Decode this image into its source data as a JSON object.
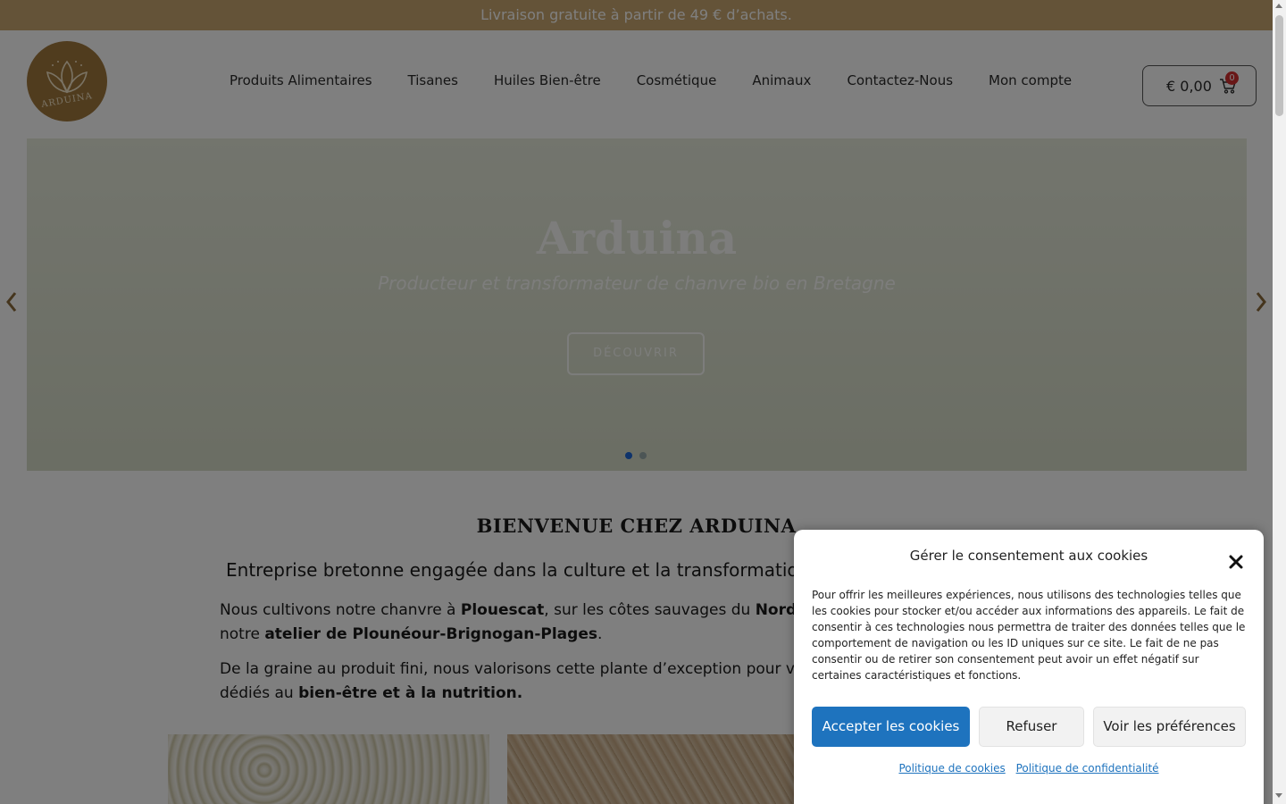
{
  "topbar": {
    "text": "Livraison gratuite à partir de 49 € d’achats."
  },
  "header": {
    "logo_text": "ARDUINA",
    "nav": [
      "Produits Alimentaires",
      "Tisanes",
      "Huiles Bien-être",
      "Cosmétique",
      "Animaux",
      "Contactez-Nous",
      "Mon compte"
    ],
    "cart": {
      "amount": "€ 0,00",
      "count": "0"
    }
  },
  "hero": {
    "title": "Arduina",
    "subtitle": "Producteur et transformateur de chanvre bio en Bretagne",
    "button": "DÉCOUVRIR",
    "slides_count": 2,
    "active_slide": 1
  },
  "content": {
    "welcome": "BIENVENUE CHEZ ARDUINA",
    "subtitle": "Entreprise bretonne engagée dans la culture et la transformatio",
    "para1": {
      "t1": "Nous cultivons notre chanvre à ",
      "b1": "Plouescat",
      "t2": ", sur les côtes sauvages du ",
      "b2": "Nord-F",
      "t3": "notre ",
      "b3": "atelier de Plounéour-Brignogan-Plages",
      "t4": "."
    },
    "para2": {
      "t1": "De la graine au produit fini, nous valorisons cette plante d’exception pour vo",
      "t2": "dédiés au ",
      "b1": "bien-être et à la nutrition."
    }
  },
  "cookie": {
    "title": "Gérer le consentement aux cookies",
    "text": "Pour offrir les meilleures expériences, nous utilisons des technologies telles que les cookies pour stocker et/ou accéder aux informations des appareils. Le fait de consentir à ces technologies nous permettra de traiter des données telles que le comportement de navigation ou les ID uniques sur ce site. Le fait de ne pas consentir ou de retirer son consentement peut avoir un effet négatif sur certaines caractéristiques et fonctions.",
    "accept": "Accepter les cookies",
    "refuse": "Refuser",
    "preferences": "Voir les préférences",
    "link_cookies": "Politique de cookies",
    "link_privacy": "Politique de confidentialité"
  },
  "colors": {
    "topbar": "#c9a770",
    "accent": "#1e73be",
    "logo": "#a1783c",
    "badge": "#d32f2f"
  },
  "icons": {
    "cart": "cart-icon",
    "close": "close-icon",
    "prev": "chevron-left-icon",
    "next": "chevron-right-icon"
  }
}
